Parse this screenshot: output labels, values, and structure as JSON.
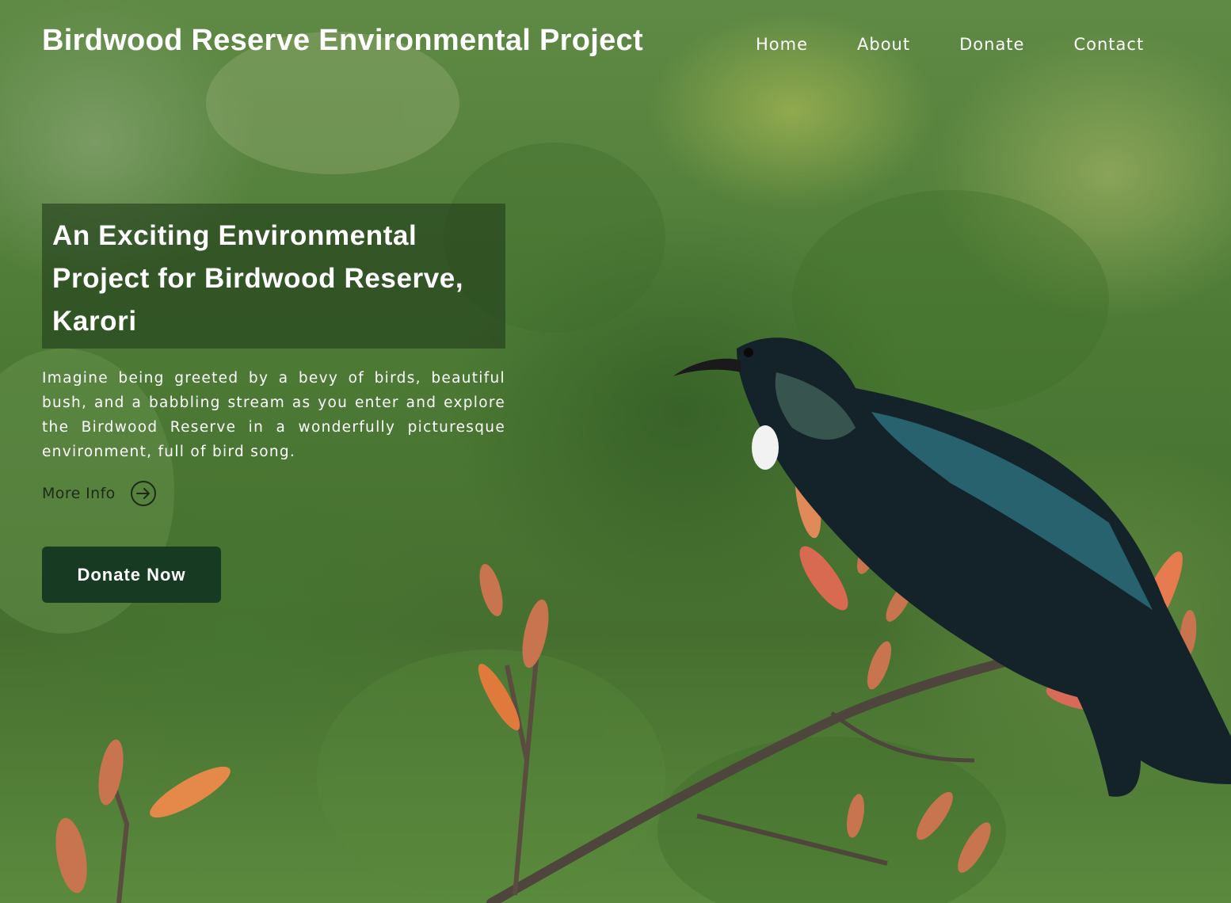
{
  "header": {
    "site_title": "Birdwood Reserve Environmental Project",
    "nav": [
      {
        "label": "Home"
      },
      {
        "label": "About"
      },
      {
        "label": "Donate"
      },
      {
        "label": "Contact"
      }
    ]
  },
  "hero": {
    "headline": "An Exciting Environmental Project for Birdwood Reserve, Karori",
    "intro": "Imagine being greeted by a bevy of birds, beautiful bush, and a babbling stream as you enter and explore the Birdwood Reserve in a wonderfully picturesque environment, full of bird song.",
    "more_info_label": "More Info",
    "more_info_icon": "arrow-right-circle-icon",
    "donate_button_label": "Donate Now",
    "background_image": "tui-bird-on-flax-flowers-photo"
  },
  "colors": {
    "button_bg": "#173b22",
    "headline_box_bg": "rgba(34,62,28,0.62)",
    "text_light": "#ffffff",
    "text_dark": "#1d2a17"
  }
}
